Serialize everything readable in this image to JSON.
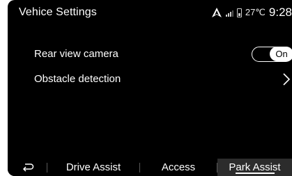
{
  "header": {
    "title": "Vehice Settings",
    "status": {
      "nav_icon": "navigation-arrow-icon",
      "signal_icon": "signal-bars-icon",
      "battery_icon": "battery-icon",
      "temperature": "27℃",
      "time": "9:28"
    }
  },
  "settings": {
    "rows": [
      {
        "label": "Rear view camera",
        "control": "toggle",
        "value": "On"
      },
      {
        "label": "Obstacle detection",
        "control": "chevron",
        "icon": "chevron-right-icon"
      }
    ]
  },
  "footer": {
    "back_icon": "back-arrow-icon",
    "tabs": [
      {
        "label": "Drive Assist"
      },
      {
        "label": "Access"
      },
      {
        "label": "Park Assist",
        "active": true
      }
    ]
  },
  "colors": {
    "background": "#000000",
    "text": "#ffffff",
    "active_tab": "#2c2c2c"
  }
}
